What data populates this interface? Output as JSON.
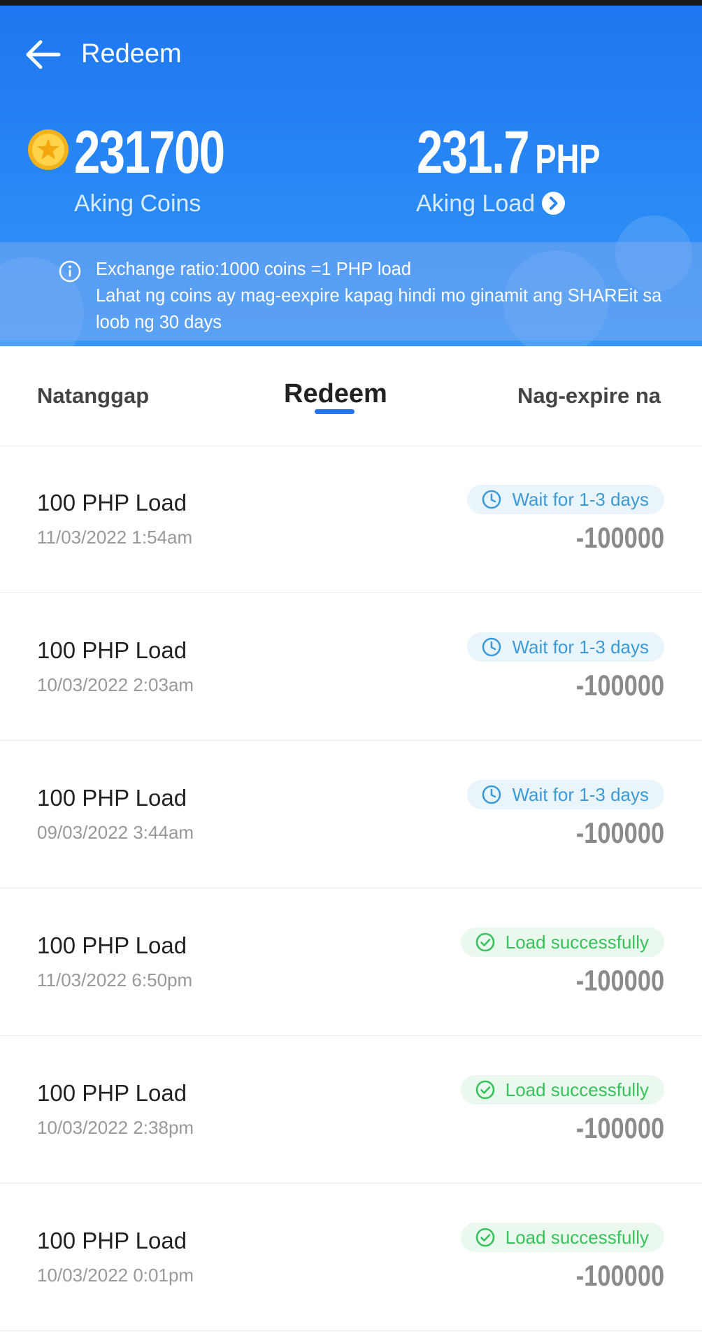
{
  "header": {
    "back_icon": "arrow-left-icon",
    "title": "Redeem",
    "coins_value": "231700",
    "coins_label": "Aking Coins",
    "load_value": "231.7",
    "load_unit": "PHP",
    "load_label": "Aking Load",
    "accent_color": "#1e76f0"
  },
  "info": {
    "icon": "info-icon",
    "line1": "Exchange ratio:1000 coins =1 PHP load",
    "line2": "Lahat ng coins ay mag-eexpire kapag hindi mo ginamit ang SHAREit sa loob ng 30 days"
  },
  "tabs": [
    {
      "label": "Natanggap",
      "active": false
    },
    {
      "label": "Redeem",
      "active": true
    },
    {
      "label": "Nag-expire na",
      "active": false
    }
  ],
  "records": [
    {
      "title": "100 PHP Load",
      "date": "11/03/2022 1:54am",
      "status": "Wait for 1-3 days",
      "status_type": "wait",
      "amount": "-100000"
    },
    {
      "title": "100 PHP Load",
      "date": "10/03/2022 2:03am",
      "status": "Wait for 1-3 days",
      "status_type": "wait",
      "amount": "-100000"
    },
    {
      "title": "100 PHP Load",
      "date": "09/03/2022 3:44am",
      "status": "Wait for 1-3 days",
      "status_type": "wait",
      "amount": "-100000"
    },
    {
      "title": "100 PHP Load",
      "date": "11/03/2022 6:50pm",
      "status": "Load successfully",
      "status_type": "ok",
      "amount": "-100000"
    },
    {
      "title": "100 PHP Load",
      "date": "10/03/2022 2:38pm",
      "status": "Load successfully",
      "status_type": "ok",
      "amount": "-100000"
    },
    {
      "title": "100 PHP Load",
      "date": "10/03/2022 0:01pm",
      "status": "Load successfully",
      "status_type": "ok",
      "amount": "-100000"
    }
  ],
  "colors": {
    "wait": "#3b9bd9",
    "ok": "#37c35c",
    "amount": "#8b8b8b"
  }
}
